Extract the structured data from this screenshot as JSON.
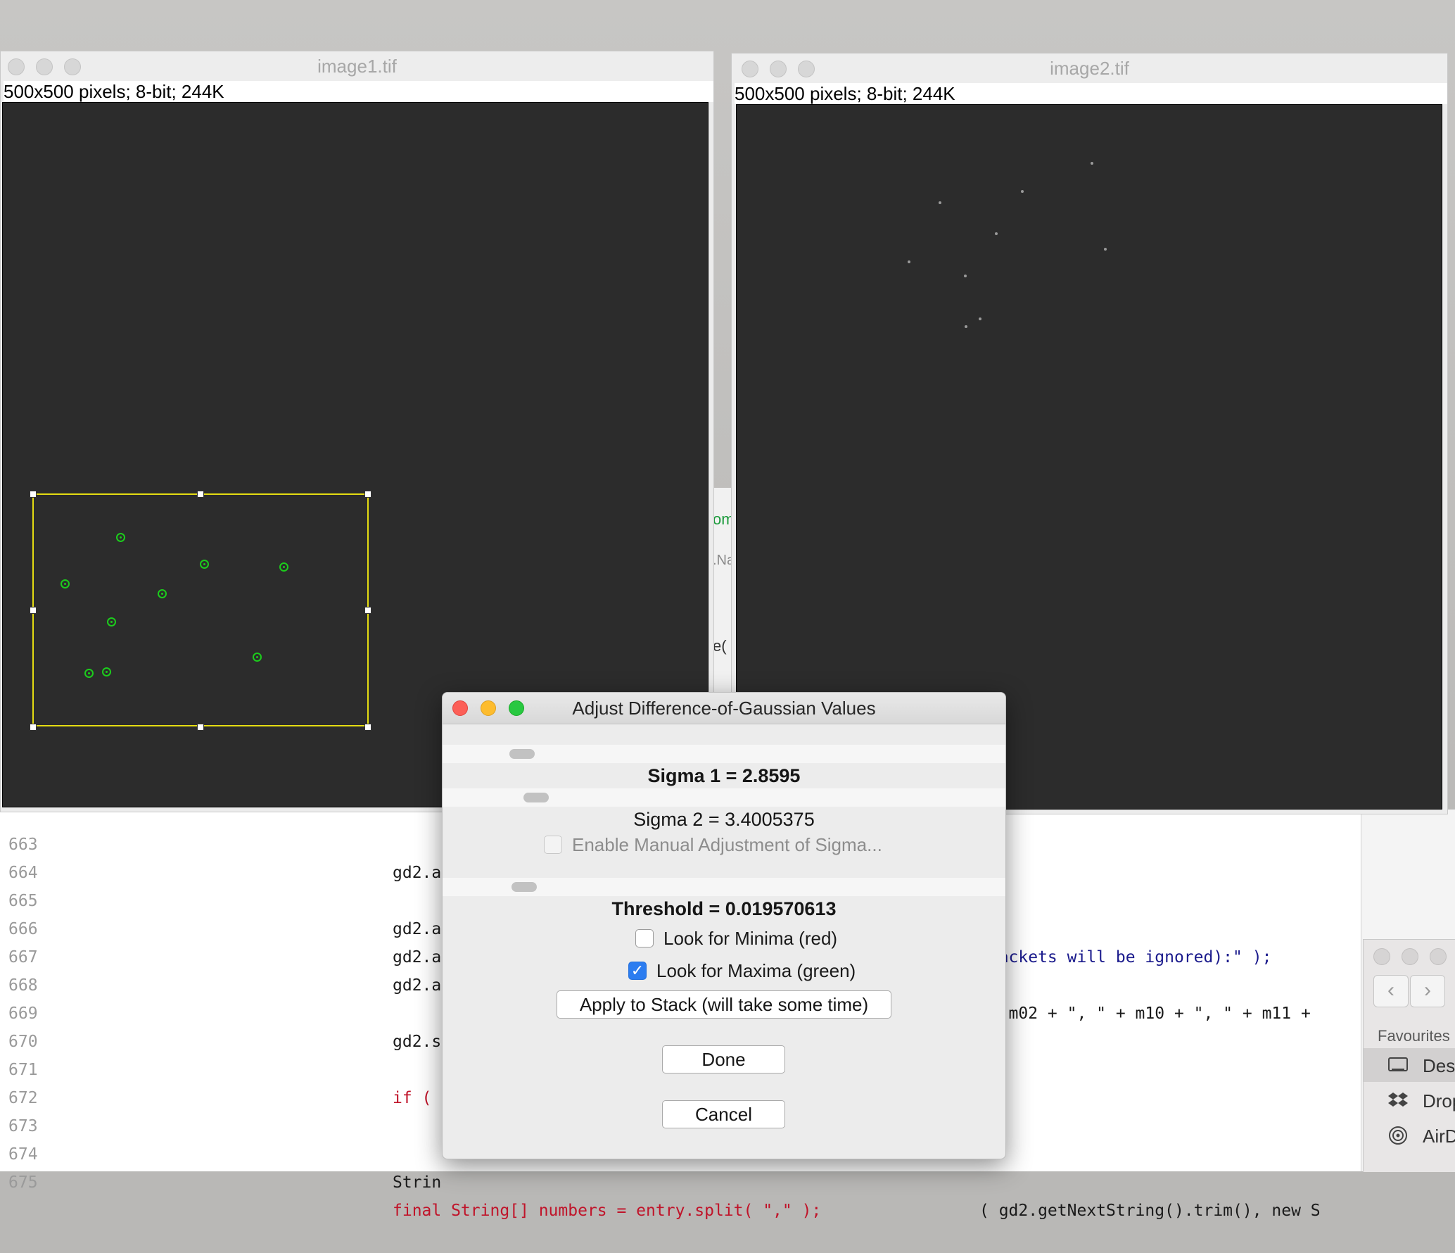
{
  "image1": {
    "title": "image1.tif",
    "info": "500x500 pixels; 8-bit; 244K"
  },
  "image2": {
    "title": "image2.tif",
    "info": "500x500 pixels; 8-bit; 244K"
  },
  "dialog": {
    "title": "Adjust Difference-of-Gaussian Values",
    "sigma1_label": "Sigma 1 = 2.8595",
    "sigma2_label": "Sigma 2 = 3.4005375",
    "manual_sigma_label": "Enable Manual Adjustment of Sigma...",
    "threshold_label": "Threshold = 0.019570613",
    "minima_label": "Look for Minima (red)",
    "maxima_label": "Look for Maxima (green)",
    "minima_checked": false,
    "maxima_checked": true,
    "manual_sigma_checked": false,
    "apply_stack_label": "Apply to Stack (will take some time)",
    "done_label": "Done",
    "cancel_label": "Cancel"
  },
  "editor": {
    "strip_green": "om",
    "strip_gray": ".Na",
    "strip_paren": "e(",
    "lines": [
      {
        "no": "663",
        "left": "gd2.a",
        "right": ""
      },
      {
        "no": "664",
        "left": "",
        "right": ""
      },
      {
        "no": "665",
        "left": "gd2.a",
        "right": "brackets will be ignored):\" );"
      },
      {
        "no": "666",
        "left": "gd2.a",
        "right": ""
      },
      {
        "no": "667",
        "left": "gd2.a",
        "right": " + m02 + \", \" + m10 + \", \" + m11 +"
      },
      {
        "no": "668",
        "left": "",
        "right": ""
      },
      {
        "no": "669",
        "left": "gd2.s",
        "right": ""
      },
      {
        "no": "670",
        "left": "",
        "right": ""
      },
      {
        "no": "671",
        "left": "if (",
        "right": ""
      },
      {
        "no": "672",
        "left": "",
        "right": ""
      },
      {
        "no": "673",
        "left": "",
        "right": ""
      },
      {
        "no": "674",
        "left": "Strin",
        "right": "( gd2.getNextString().trim(), new S"
      },
      {
        "no": "675",
        "left": "final String[] numbers = entry.split( \",\" );",
        "right": ""
      }
    ]
  },
  "finder": {
    "favourites_label": "Favourites",
    "items": [
      {
        "label": "Des",
        "icon": "desktop-icon"
      },
      {
        "label": "Drop",
        "icon": "dropbox-icon"
      },
      {
        "label": "AirD",
        "icon": "airdrop-icon"
      }
    ]
  },
  "colors": {
    "roi": "#e4dc12",
    "maxima": "#1ccc1c",
    "checkbox_accent": "#2b7cf0",
    "close": "#fc5f57",
    "minimize": "#fdbc2e",
    "zoom": "#28c840"
  }
}
